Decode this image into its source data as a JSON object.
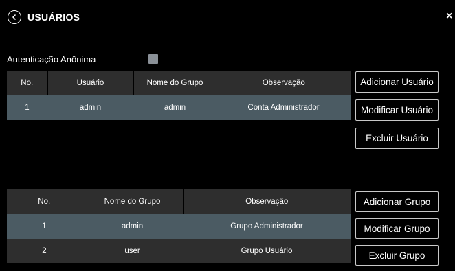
{
  "header": {
    "title": "USUÁRIOS",
    "close_symbol": "×",
    "back_icon": "chevron-left-circle-icon"
  },
  "anonymous_auth": {
    "label": "Autenticação Anônima",
    "checked": false
  },
  "users_table": {
    "headers": [
      "No.",
      "Usuário",
      "Nome do Grupo",
      "Observação"
    ],
    "rows": [
      {
        "no": "1",
        "user": "admin",
        "group": "admin",
        "note": "Conta Administrador"
      }
    ]
  },
  "user_buttons": {
    "add": "Adicionar Usuário",
    "modify": "Modificar Usuário",
    "delete": "Excluir Usuário"
  },
  "groups_table": {
    "headers": [
      "No.",
      "Nome do Grupo",
      "Observação"
    ],
    "rows": [
      {
        "no": "1",
        "group": "admin",
        "note": "Grupo Administrador"
      },
      {
        "no": "2",
        "group": "user",
        "note": "Grupo Usuário"
      }
    ]
  },
  "group_buttons": {
    "add": "Adicionar Grupo",
    "modify": "Modificar Grupo",
    "delete": "Excluir Grupo"
  },
  "colors": {
    "background": "#000000",
    "header_cell": "#2e2e2e",
    "selected_row": "#4b5b63",
    "checkbox": "#8a9097"
  }
}
